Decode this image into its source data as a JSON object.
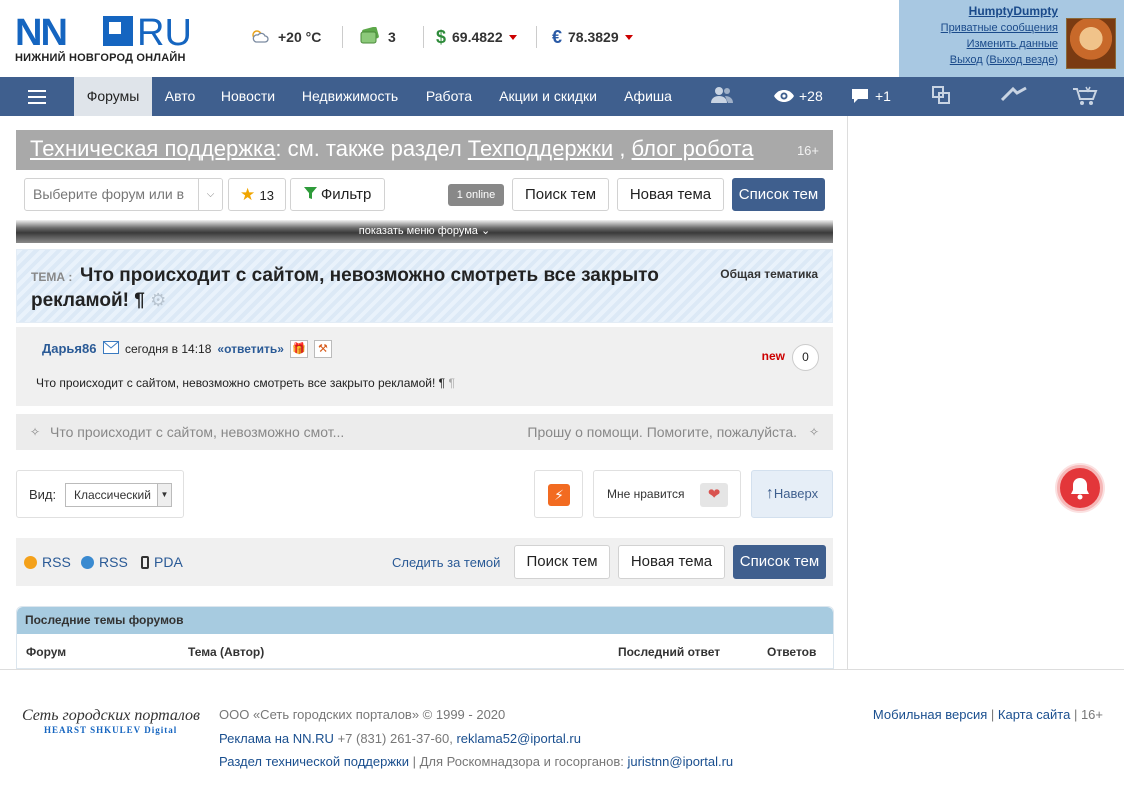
{
  "header": {
    "logo_main": "NN",
    "logo_ru": "RU",
    "logo_subtitle": "НИЖНИЙ НОВГОРОД ОНЛАЙН",
    "weather": "+20 °C",
    "messages_count": "3",
    "usd_rate": "69.4822",
    "eur_rate": "78.3829"
  },
  "user": {
    "name": "HumptyDumpty",
    "private_messages": "Приватные сообщения",
    "edit_profile": "Изменить данные",
    "logout": "Выход",
    "logout_everywhere": "Выход везде"
  },
  "nav": {
    "items": [
      "Форумы",
      "Авто",
      "Новости",
      "Недвижимость",
      "Работа",
      "Акции и скидки",
      "Афиша"
    ],
    "active": "Форумы",
    "views": "+28",
    "comments": "+1"
  },
  "forum": {
    "title_link1": "Техническая поддержка",
    "title_mid": ": см. также раздел ",
    "title_link2": "Техподдержки",
    "title_sep": " , ",
    "title_link3": "блог робота",
    "age": "16+",
    "select_placeholder": "Выберите форум или в",
    "favorites": "13",
    "filter": "Фильтр",
    "online": "1 online",
    "search": "Поиск тем",
    "new_topic": "Новая тема",
    "topic_list": "Список тем",
    "show_menu": "показать меню форума"
  },
  "topic": {
    "label": "ТЕМА :",
    "title": "Что происходит с сайтом, невозможно смотреть все закрыто рекламой! ¶",
    "category": "Общая тематика"
  },
  "post": {
    "author": "Дарья86",
    "time": "сегодня в 14:18",
    "reply": "«ответить»",
    "new_label": "new",
    "rating": "0",
    "body": "Что происходит с сайтом, невозможно смотреть все закрыто рекламой! ¶"
  },
  "pager": {
    "prev": "Что происходит с сайтом, невозможно смот...",
    "next": "Прошу о помощи. Помогите, пожалуйста."
  },
  "view": {
    "label": "Вид:",
    "mode": "Классический",
    "like": "Мне нравится",
    "up": "Наверх"
  },
  "bottom": {
    "rss1": "RSS",
    "rss2": "RSS",
    "pda": "PDA",
    "follow": "Следить за темой"
  },
  "latest": {
    "title": "Последние темы форумов",
    "columns": [
      "Форум",
      "Тема (Автор)",
      "Последний ответ",
      "Ответов"
    ]
  },
  "footer": {
    "network_name": "Сеть городских порталов",
    "network_sub": "HEARST SHKULEV Digital",
    "copyright": "ООО «Сеть городских порталов» © 1999 - 2020",
    "ads_link": "Реклама на NN.RU",
    "phone": " +7 (831) 261-37-60, ",
    "ads_email": "reklama52@iportal.ru",
    "support_link": "Раздел технической поддержки",
    "rkn_text": " | Для Роскомнадзора и госорганов: ",
    "legal_email": "juristnn@iportal.ru",
    "mobile": "Мобильная версия",
    "sitemap": "Карта сайта",
    "age": "16+"
  },
  "colors": {
    "brand_blue": "#1565c0",
    "nav_bg": "#3f5f8e",
    "alert_red": "#e3363a"
  }
}
